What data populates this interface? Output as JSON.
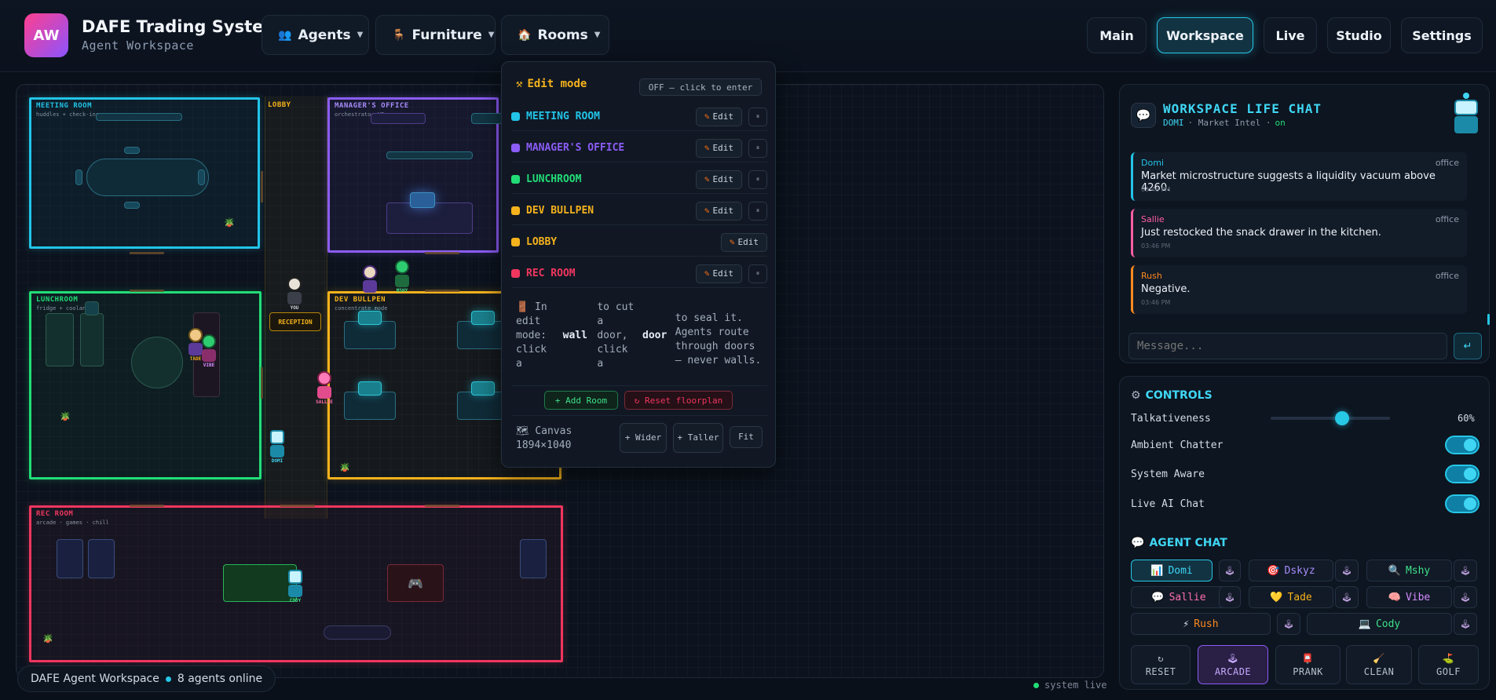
{
  "brand": {
    "logo": "AW",
    "title": "DAFE Trading System",
    "subtitle": "Agent Workspace"
  },
  "menus": [
    {
      "icon": "👥",
      "label": "Agents"
    },
    {
      "icon": "🪑",
      "label": "Furniture"
    },
    {
      "icon": "🏠",
      "label": "Rooms"
    }
  ],
  "nav": [
    "Main",
    "Workspace",
    "Live",
    "Studio",
    "Settings"
  ],
  "nav_active": "Workspace",
  "rooms": {
    "meeting": {
      "name": "MEETING ROOM",
      "sub": "huddles + check-ins"
    },
    "lobby": {
      "name": "LOBBY"
    },
    "manager": {
      "name": "MANAGER'S OFFICE",
      "sub": "orchestrator HQ"
    },
    "lunch": {
      "name": "LUNCHROOM",
      "sub": "fridge + coolant"
    },
    "dev": {
      "name": "DEV BULLPEN",
      "sub": "concentrate mode"
    },
    "rec": {
      "name": "REC ROOM",
      "sub": "arcade · games · chill"
    },
    "reception": "RECEPTION",
    "you": "YOU"
  },
  "agents_on_map": [
    "YOU",
    "MSHY",
    "TADE",
    "VIBE",
    "SALLIE",
    "DOMI",
    "CODY"
  ],
  "popup": {
    "edit_mode": "Edit mode",
    "edit_state": "OFF — click to enter",
    "rows": [
      {
        "name": "MEETING ROOM",
        "color": "#22c4e8"
      },
      {
        "name": "MANAGER'S OFFICE",
        "color": "#8b5cf6"
      },
      {
        "name": "LUNCHROOM",
        "color": "#22dd77"
      },
      {
        "name": "DEV BULLPEN",
        "color": "#f5b21c"
      },
      {
        "name": "LOBBY",
        "color": "#f5b21c"
      },
      {
        "name": "REC ROOM",
        "color": "#f0365e"
      }
    ],
    "edit_label": "Edit",
    "help": {
      "c1": "🚪 In edit mode: click a",
      "b1": "wall",
      "c2": "to cut a door, click a",
      "b2": "door",
      "c3": "to seal it. Agents route through doors — never walls."
    },
    "add_room": "+ Add Room",
    "reset_floorplan": "↻ Reset floorplan",
    "canvas_label": "🗺 Canvas 1894×1040",
    "wider": "+ Wider",
    "taller": "+ Taller",
    "fit": "Fit"
  },
  "stage_footer": {
    "title": "DAFE Agent Workspace",
    "online": "8 agents online"
  },
  "system_live": "system live",
  "chat": {
    "title": "WORKSPACE LIFE CHAT",
    "sub_name": "DOMI",
    "sub_role": "· Market Intel ·",
    "sub_status": "on",
    "messages": [
      {
        "who": "Domi",
        "where": "office",
        "text": "Market microstructure suggests a liquidity vacuum above 4260.",
        "time": "03:46 PM",
        "color": "#22c4e8"
      },
      {
        "who": "Sallie",
        "where": "office",
        "text": "Just restocked the snack drawer in the kitchen.",
        "time": "03:46 PM",
        "color": "#ff5fa2"
      },
      {
        "who": "Rush",
        "where": "office",
        "text": "Negative.",
        "time": "03:46 PM",
        "color": "#ff8a1f"
      }
    ],
    "placeholder": "Message...",
    "send": "↵"
  },
  "controls": {
    "title": "CONTROLS",
    "talkativeness": {
      "label": "Talkativeness",
      "value": "60%",
      "fraction": 0.6
    },
    "toggles": [
      "Ambient Chatter",
      "System Aware",
      "Live AI Chat"
    ]
  },
  "agent_chat": {
    "title": "AGENT CHAT",
    "agents": [
      {
        "icon": "📊",
        "name": "Domi",
        "color": "#3fd6f4"
      },
      {
        "icon": "🎯",
        "name": "Dskyz",
        "color": "#a78bfa"
      },
      {
        "icon": "🔍",
        "name": "Mshy",
        "color": "#3ee08a"
      },
      {
        "icon": "💬",
        "name": "Sallie",
        "color": "#ff6fae"
      },
      {
        "icon": "💛",
        "name": "Tade",
        "color": "#f5b21c"
      },
      {
        "icon": "🧠",
        "name": "Vibe",
        "color": "#d58bff"
      },
      {
        "icon": "⚡",
        "name": "Rush",
        "color": "#ff8a1f"
      },
      {
        "icon": "💻",
        "name": "Cody",
        "color": "#3ee08a"
      }
    ],
    "joy": "🕹"
  },
  "actions": [
    {
      "icon": "↻",
      "label": "RESET"
    },
    {
      "icon": "🕹",
      "label": "ARCADE"
    },
    {
      "icon": "📮",
      "label": "PRANK"
    },
    {
      "icon": "🧹",
      "label": "CLEAN"
    },
    {
      "icon": "⛳",
      "label": "GOLF"
    }
  ]
}
